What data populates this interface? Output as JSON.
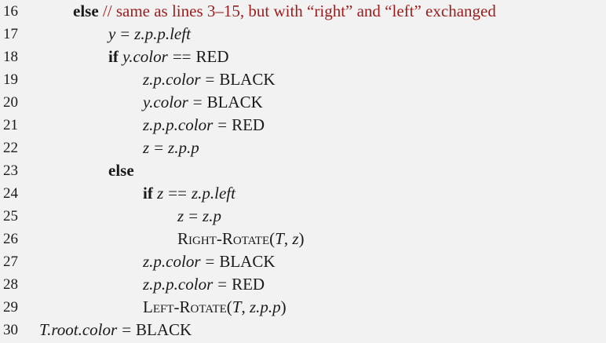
{
  "lines": [
    {
      "num": "16",
      "parts": [
        {
          "t": "else",
          "c": "kw"
        },
        {
          "t": " // same as lines 3–15, but with “right” and “left” exchanged",
          "c": "cm"
        }
      ]
    },
    {
      "num": "17",
      "parts": [
        {
          "t": "y",
          "c": "it"
        },
        {
          "t": "=",
          "c": "op"
        },
        {
          "t": "z.p.p.left",
          "c": "it"
        }
      ]
    },
    {
      "num": "18",
      "parts": [
        {
          "t": "if ",
          "c": "kw"
        },
        {
          "t": "y.color",
          "c": "it"
        },
        {
          "t": "==",
          "c": "op"
        },
        {
          "t": "RED",
          "c": "sc"
        }
      ]
    },
    {
      "num": "19",
      "parts": [
        {
          "t": "z.p.color",
          "c": "it"
        },
        {
          "t": "=",
          "c": "op"
        },
        {
          "t": "BLACK",
          "c": "sc"
        }
      ]
    },
    {
      "num": "20",
      "parts": [
        {
          "t": "y.color",
          "c": "it"
        },
        {
          "t": "=",
          "c": "op"
        },
        {
          "t": "BLACK",
          "c": "sc"
        }
      ]
    },
    {
      "num": "21",
      "parts": [
        {
          "t": "z.p.p.color",
          "c": "it"
        },
        {
          "t": "=",
          "c": "op"
        },
        {
          "t": "RED",
          "c": "sc"
        }
      ]
    },
    {
      "num": "22",
      "parts": [
        {
          "t": "z",
          "c": "it"
        },
        {
          "t": "=",
          "c": "op"
        },
        {
          "t": "z.p.p",
          "c": "it"
        }
      ]
    },
    {
      "num": "23",
      "parts": [
        {
          "t": "else",
          "c": "kw"
        }
      ]
    },
    {
      "num": "24",
      "parts": [
        {
          "t": "if ",
          "c": "kw"
        },
        {
          "t": "z",
          "c": "it"
        },
        {
          "t": "==",
          "c": "op"
        },
        {
          "t": "z.p.left",
          "c": "it"
        }
      ]
    },
    {
      "num": "25",
      "parts": [
        {
          "t": "z",
          "c": "it"
        },
        {
          "t": "=",
          "c": "op"
        },
        {
          "t": "z.p",
          "c": "it"
        }
      ]
    },
    {
      "num": "26",
      "parts": [
        {
          "t": "Right-Rotate",
          "c": "sc"
        },
        {
          "t": "(",
          "c": ""
        },
        {
          "t": "T",
          "c": "it"
        },
        {
          "t": ", ",
          "c": ""
        },
        {
          "t": "z",
          "c": "it"
        },
        {
          "t": ")",
          "c": ""
        }
      ]
    },
    {
      "num": "27",
      "parts": [
        {
          "t": "z.p.color",
          "c": "it"
        },
        {
          "t": "=",
          "c": "op"
        },
        {
          "t": "BLACK",
          "c": "sc"
        }
      ]
    },
    {
      "num": "28",
      "parts": [
        {
          "t": "z.p.p.color",
          "c": "it"
        },
        {
          "t": "=",
          "c": "op"
        },
        {
          "t": "RED",
          "c": "sc"
        }
      ]
    },
    {
      "num": "29",
      "parts": [
        {
          "t": "Left-Rotate",
          "c": "sc"
        },
        {
          "t": "(",
          "c": ""
        },
        {
          "t": "T",
          "c": "it"
        },
        {
          "t": ", ",
          "c": ""
        },
        {
          "t": "z.p.p",
          "c": "it"
        },
        {
          "t": ")",
          "c": ""
        }
      ]
    },
    {
      "num": "30",
      "parts": [
        {
          "t": "T.root.color",
          "c": "it"
        },
        {
          "t": "=",
          "c": "op"
        },
        {
          "t": "BLACK",
          "c": "sc"
        }
      ]
    }
  ],
  "colors": {
    "background": "#f2f2f2",
    "text": "#1a1a1a",
    "comment": "#9b1c1c"
  }
}
